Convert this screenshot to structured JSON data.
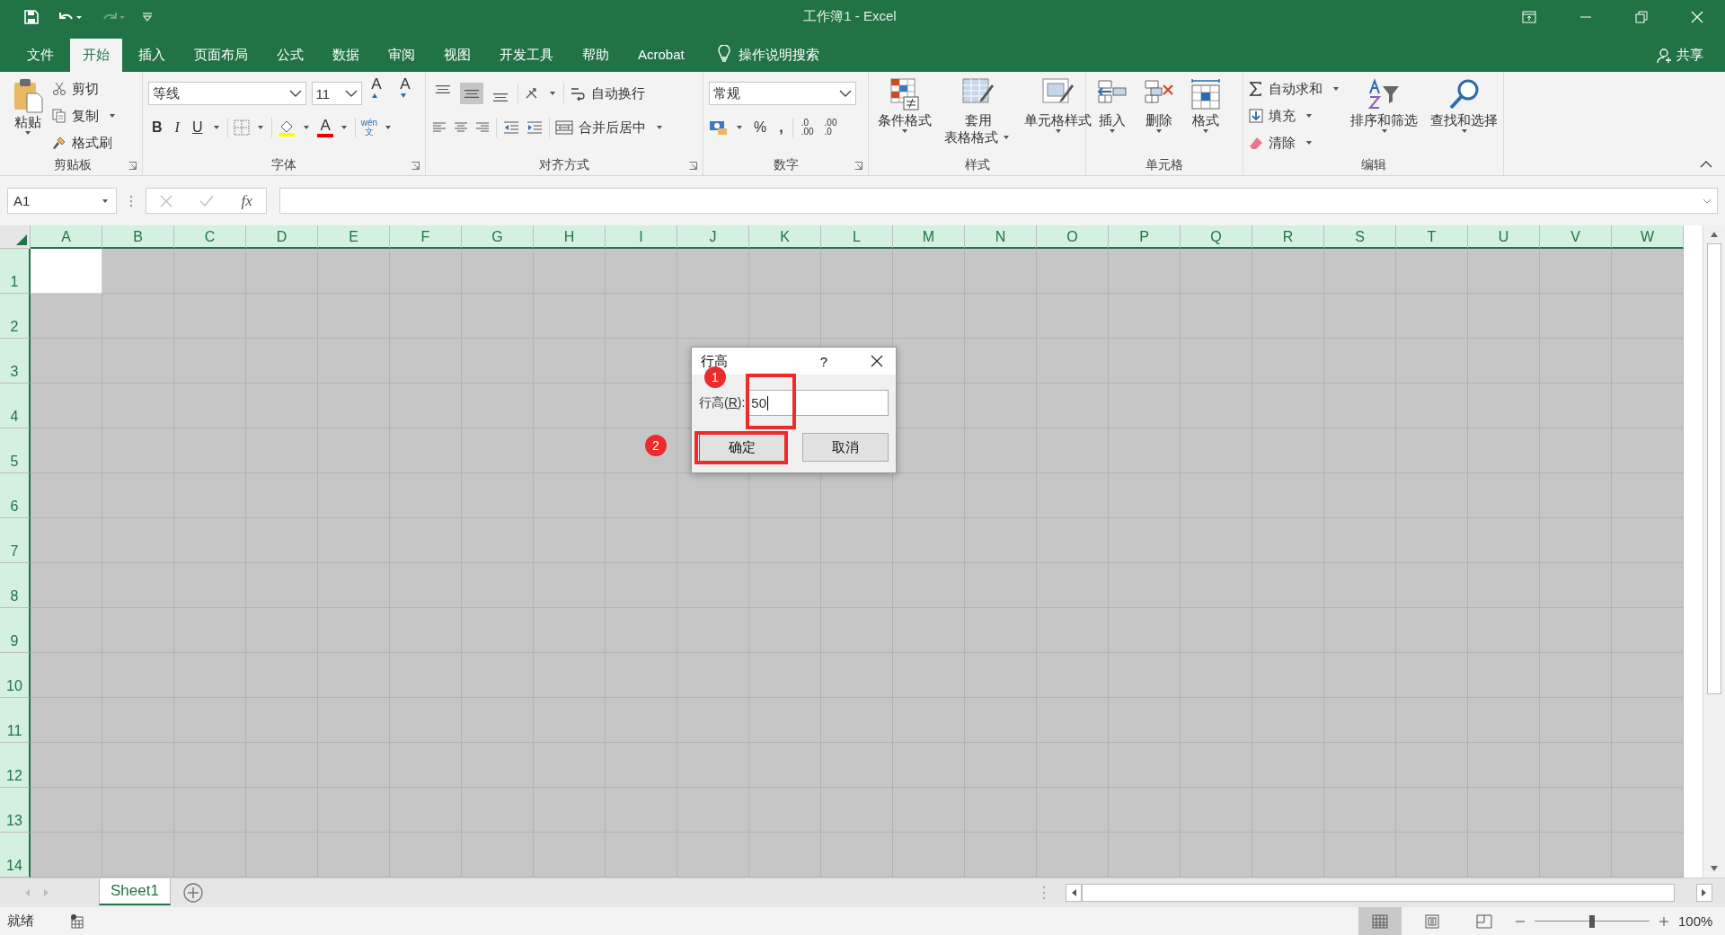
{
  "window": {
    "title": "工作簿1  -  Excel"
  },
  "ribbon_tabs": [
    {
      "label": "文件",
      "selected": false
    },
    {
      "label": "开始",
      "selected": true
    },
    {
      "label": "插入",
      "selected": false
    },
    {
      "label": "页面布局",
      "selected": false
    },
    {
      "label": "公式",
      "selected": false
    },
    {
      "label": "数据",
      "selected": false
    },
    {
      "label": "审阅",
      "selected": false
    },
    {
      "label": "视图",
      "selected": false
    },
    {
      "label": "开发工具",
      "selected": false
    },
    {
      "label": "帮助",
      "selected": false
    },
    {
      "label": "Acrobat",
      "selected": false
    }
  ],
  "tell_me": {
    "placeholder": "操作说明搜索"
  },
  "share": {
    "label": "共享"
  },
  "clipboard": {
    "paste": "粘贴",
    "cut": "剪切",
    "copy": "复制",
    "format_painter": "格式刷",
    "label": "剪贴板"
  },
  "font": {
    "name": "等线",
    "size": "11",
    "grow": "A",
    "shrink": "A",
    "bold": "B",
    "italic": "I",
    "underline": "U",
    "color_glyph": "A",
    "phonetic_top": "wén",
    "phonetic_bottom": "文",
    "label": "字体"
  },
  "alignment": {
    "vertical": [
      {
        "selected": false
      },
      {
        "selected": true
      },
      {
        "selected": false
      }
    ],
    "wrap": "自动换行",
    "merge": "合并后居中",
    "label": "对齐方式"
  },
  "number": {
    "format": "常规",
    "percent": "%",
    "comma": ",",
    "increase_decimal": {
      "top": ".0",
      "bottom": ".00"
    },
    "decrease_decimal": {
      "top": ".00",
      "bottom": ".0"
    },
    "label": "数字"
  },
  "styles": {
    "conditional": "条件格式",
    "table_top": "套用",
    "table_bottom": "表格格式",
    "cell_styles": "单元格样式",
    "label": "样式"
  },
  "cells": {
    "insert": "插入",
    "delete": "删除",
    "format": "格式",
    "label": "单元格"
  },
  "editing": {
    "autosum": "自动求和",
    "fill": "填充",
    "clear": "清除",
    "sort": "排序和筛选",
    "find": "查找和选择",
    "label": "编辑"
  },
  "formula_bar": {
    "name_box": "A1",
    "fx": "fx"
  },
  "sheet": {
    "columns": [
      {
        "label": "A",
        "selected": true
      },
      {
        "label": "B",
        "selected": true
      },
      {
        "label": "C",
        "selected": true
      },
      {
        "label": "D",
        "selected": true
      },
      {
        "label": "E",
        "selected": true
      },
      {
        "label": "F",
        "selected": true
      },
      {
        "label": "G",
        "selected": true
      },
      {
        "label": "H",
        "selected": true
      },
      {
        "label": "I",
        "selected": true
      },
      {
        "label": "J",
        "selected": true
      },
      {
        "label": "K",
        "selected": true
      },
      {
        "label": "L",
        "selected": true
      },
      {
        "label": "M",
        "selected": true
      },
      {
        "label": "N",
        "selected": true
      },
      {
        "label": "O",
        "selected": true
      },
      {
        "label": "P",
        "selected": true
      },
      {
        "label": "Q",
        "selected": true
      },
      {
        "label": "R",
        "selected": true
      },
      {
        "label": "S",
        "selected": true
      },
      {
        "label": "T",
        "selected": true
      },
      {
        "label": "U",
        "selected": true
      },
      {
        "label": "V",
        "selected": true
      },
      {
        "label": "W",
        "selected": true
      }
    ],
    "rows": [
      {
        "label": "1",
        "selected": true
      },
      {
        "label": "2",
        "selected": true
      },
      {
        "label": "3",
        "selected": true
      },
      {
        "label": "4",
        "selected": true
      },
      {
        "label": "5",
        "selected": true
      },
      {
        "label": "6",
        "selected": true
      },
      {
        "label": "7",
        "selected": true
      },
      {
        "label": "8",
        "selected": true
      },
      {
        "label": "9",
        "selected": true
      },
      {
        "label": "10",
        "selected": true
      },
      {
        "label": "11",
        "selected": true
      },
      {
        "label": "12",
        "selected": true
      },
      {
        "label": "13",
        "selected": true
      },
      {
        "label": "14",
        "selected": true
      }
    ]
  },
  "dialog": {
    "title": "行高",
    "help": "?",
    "label_before": "行高(",
    "access_key": "R",
    "label_after": "):",
    "value": "50",
    "ok": "确定",
    "cancel": "取消"
  },
  "annotations": [
    {
      "number": "1"
    },
    {
      "number": "2"
    }
  ],
  "sheet_tabs": [
    {
      "label": "Sheet1",
      "selected": true
    }
  ],
  "status_bar": {
    "text": "就绪",
    "views": [
      {
        "kind": "normal",
        "selected": true
      },
      {
        "kind": "layout",
        "selected": false
      },
      {
        "kind": "pagebreak",
        "selected": false
      }
    ],
    "zoom": {
      "level": 0.5,
      "reading": "100%"
    }
  }
}
